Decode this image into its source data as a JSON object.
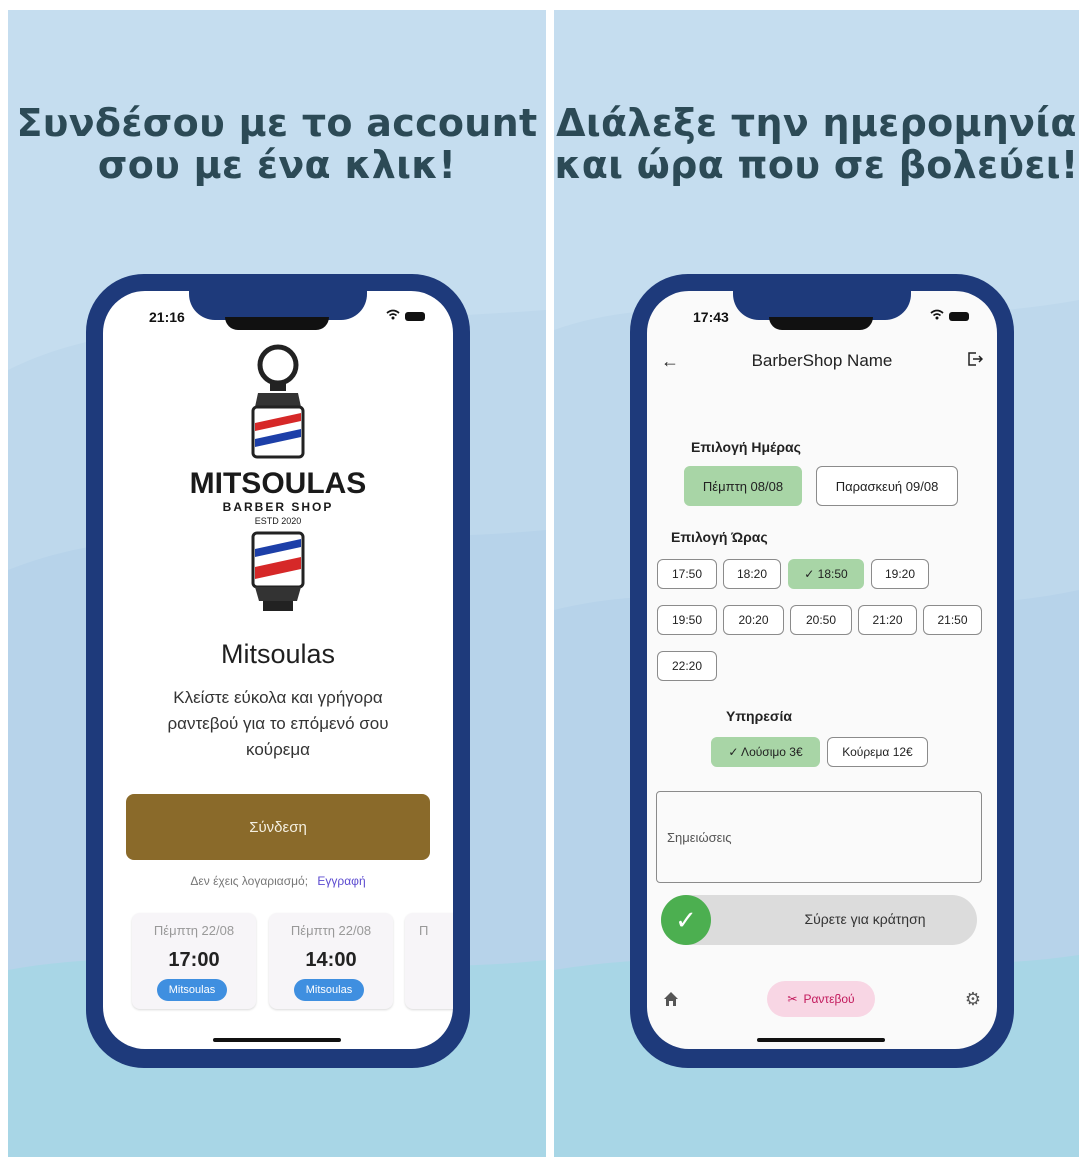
{
  "left_panel": {
    "headline": [
      "Συνδέσου με το account",
      "σου με ένα κλικ!"
    ],
    "status_time": "21:16",
    "logo": {
      "brand": "MITSOULAS",
      "sub": "BARBER SHOP",
      "estd": "ESTD 2020"
    },
    "shop_name": "Mitsoulas",
    "description": [
      "Κλείστε εύκολα και γρήγορα",
      "ραντεβού για το επόμενό σου",
      "κούρεμα"
    ],
    "login_label": "Σύνδεση",
    "register_prompt": "Δεν έχεις λογαριασμό;",
    "register_link": "Εγγραφή",
    "appointments": [
      {
        "date": "Πέμπτη 22/08",
        "time": "17:00",
        "shop": "Mitsoulas"
      },
      {
        "date": "Πέμπτη 22/08",
        "time": "14:00",
        "shop": "Mitsoulas"
      },
      {
        "date": "Π",
        "time": "",
        "shop": ""
      }
    ]
  },
  "right_panel": {
    "headline": [
      "Διάλεξε την ημερομηνία",
      "και ώρα που σε βολεύει!"
    ],
    "status_time": "17:43",
    "title": "BarberShop Name",
    "day_section": "Επιλογή Ημέρας",
    "days": [
      {
        "label": "Πέμπτη 08/08",
        "selected": true
      },
      {
        "label": "Παρασκευή 09/08",
        "selected": false
      }
    ],
    "time_section": "Επιλογή Ώρας",
    "times": [
      {
        "label": "17:50",
        "selected": false
      },
      {
        "label": "18:20",
        "selected": false
      },
      {
        "label": "✓ 18:50",
        "selected": true
      },
      {
        "label": "19:20",
        "selected": false
      },
      {
        "label": "19:50",
        "selected": false
      },
      {
        "label": "20:20",
        "selected": false
      },
      {
        "label": "20:50",
        "selected": false
      },
      {
        "label": "21:20",
        "selected": false
      },
      {
        "label": "21:50",
        "selected": false
      },
      {
        "label": "22:20",
        "selected": false
      }
    ],
    "service_section": "Υπηρεσία",
    "services": [
      {
        "label": "✓ Λούσιμο 3€",
        "selected": true
      },
      {
        "label": "Κούρεμα 12€",
        "selected": false
      }
    ],
    "notes_placeholder": "Σημειώσεις",
    "slider_label": "Σύρετε για κράτηση",
    "nav_appointments": "Ραντεβού"
  },
  "colors": {
    "background": "#c5ddef",
    "phone_frame": "#1e3a7b",
    "login_button": "#8a6a2a",
    "selected_chip": "#a8d5a6",
    "badge": "#3f8fe0",
    "register_link": "#5b4ad0",
    "nav_active": "#f8d6e4",
    "slider_thumb": "#4caf50"
  },
  "icons": [
    "wifi-icon",
    "battery-icon",
    "back-arrow-icon",
    "logout-icon",
    "check-icon",
    "home-icon",
    "scissors-icon",
    "settings-icon"
  ]
}
